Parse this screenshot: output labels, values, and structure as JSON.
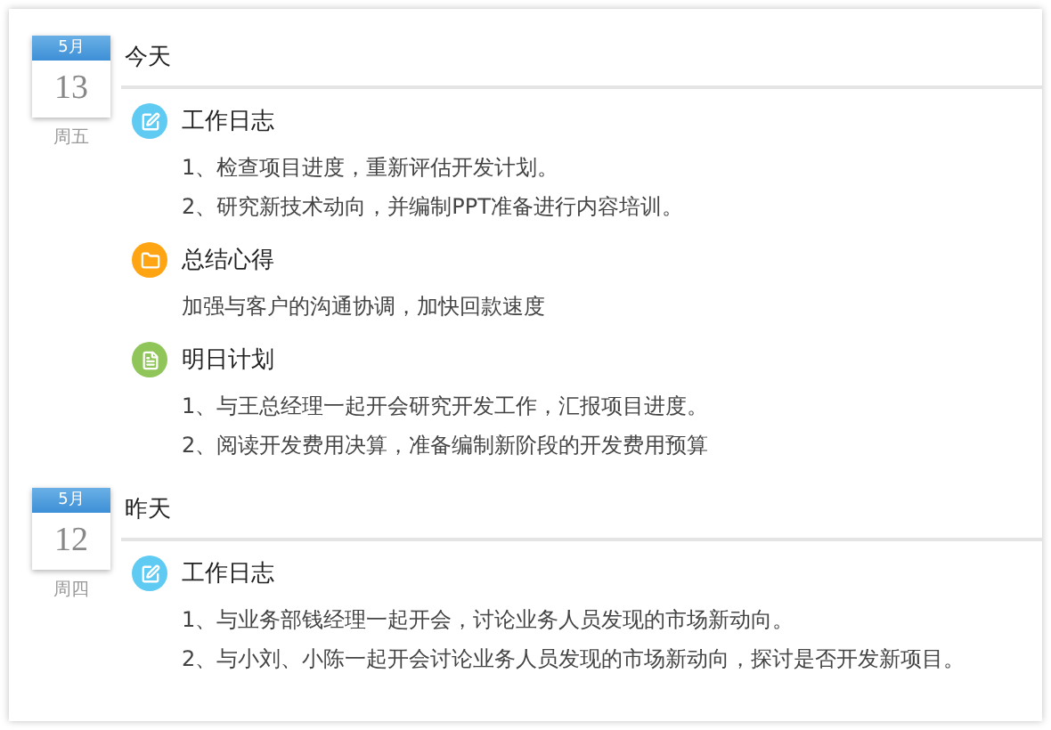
{
  "days": [
    {
      "month": "5月",
      "date": "13",
      "weekday": "周五",
      "label": "今天",
      "entries": [
        {
          "kind": "log",
          "title": "工作日志",
          "lines": [
            "1、检查项目进度，重新评估开发计划。",
            "2、研究新技术动向，并编制PPT准备进行内容培训。"
          ]
        },
        {
          "kind": "summary",
          "title": "总结心得",
          "lines": [
            "加强与客户的沟通协调，加快回款速度"
          ]
        },
        {
          "kind": "plan",
          "title": "明日计划",
          "lines": [
            "1、与王总经理一起开会研究开发工作，汇报项目进度。",
            "2、阅读开发费用决算，准备编制新阶段的开发费用预算"
          ]
        }
      ]
    },
    {
      "month": "5月",
      "date": "12",
      "weekday": "周四",
      "label": "昨天",
      "entries": [
        {
          "kind": "log",
          "title": "工作日志",
          "lines": [
            "1、与业务部钱经理一起开会，讨论业务人员发现的市场新动向。",
            "2、与小刘、小陈一起开会讨论业务人员发现的市场新动向，探讨是否开发新项目。"
          ]
        }
      ]
    }
  ]
}
